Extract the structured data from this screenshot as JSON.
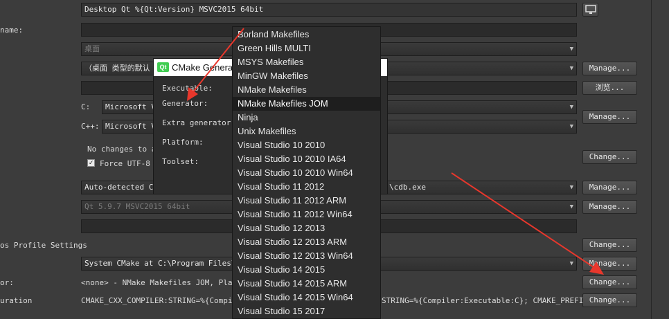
{
  "fields": {
    "name_value": "Desktop Qt %{Qt:Version} MSVC2015 64bit",
    "device_combo": "桌面",
    "device_type_combo": "（桌面 类型的默认",
    "c_label": "C:",
    "c_combo": "Microsoft Vi",
    "cpp_label": "C++:",
    "cpp_combo": "Microsoft Vi",
    "env_line1": "No changes to ap",
    "env_checkbox": "Force UTF-8 M",
    "debugger_combo": "Auto-detected CDB",
    "debugger_path": "\\cdb.exe",
    "qt_version_combo": "Qt 5.9.7 MSVC2015 64bit",
    "cmake_tool_combo": "System CMake at C:\\Program Files\\CMa",
    "cmake_generator_value": "<none> - NMake Makefiles JOM, Platfor",
    "cmake_config_value": "CMAKE_CXX_COMPILER:STRING=%{Compiler",
    "cmake_config_value_right": "STRING=%{Compiler:Executable:C}; CMAKE_PREFIX_…"
  },
  "left_labels": {
    "name": "name:",
    "profile_settings": "os Profile Settings",
    "generator": "or:",
    "configuration": "uration"
  },
  "buttons": {
    "manage_device": "Manage...",
    "browse": "浏览...",
    "manage_compiler": "Manage...",
    "change_env": "Change...",
    "manage_debugger": "Manage...",
    "manage_qt": "Manage...",
    "change_profile": "Change...",
    "manage_cmake": "Manage...",
    "change_generator": "Change...",
    "change_config": "Change..."
  },
  "dialog": {
    "title": "CMake Genera",
    "labels": [
      "Executable:",
      "Generator:",
      "Extra generator:",
      "Platform:",
      "Toolset:"
    ]
  },
  "generator_dropdown": {
    "selected": "NMake Makefiles JOM",
    "items": [
      "Borland Makefiles",
      "Green Hills MULTI",
      "MSYS Makefiles",
      "MinGW Makefiles",
      "NMake Makefiles",
      "NMake Makefiles JOM",
      "Ninja",
      "Unix Makefiles",
      "Visual Studio 10 2010",
      "Visual Studio 10 2010 IA64",
      "Visual Studio 10 2010 Win64",
      "Visual Studio 11 2012",
      "Visual Studio 11 2012 ARM",
      "Visual Studio 11 2012 Win64",
      "Visual Studio 12 2013",
      "Visual Studio 12 2013 ARM",
      "Visual Studio 12 2013 Win64",
      "Visual Studio 14 2015",
      "Visual Studio 14 2015 ARM",
      "Visual Studio 14 2015 Win64",
      "Visual Studio 15 2017"
    ]
  },
  "annotation_color": "#e8372c"
}
